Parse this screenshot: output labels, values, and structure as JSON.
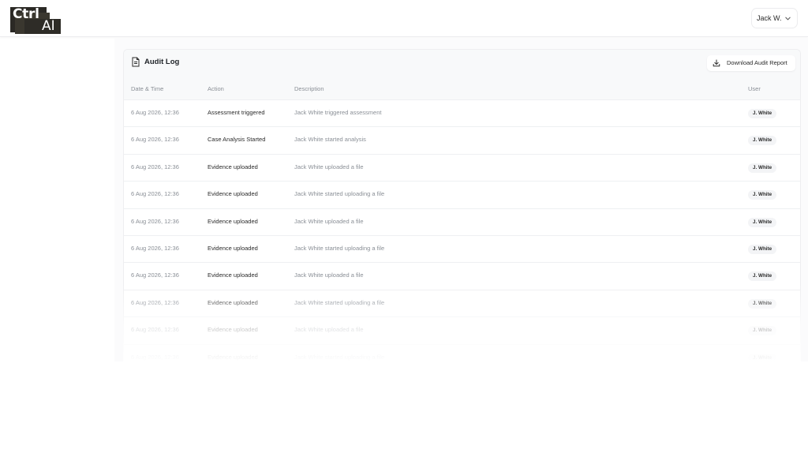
{
  "brand": {
    "line1": "Ctrl",
    "line2": "AI"
  },
  "user_menu": {
    "label": "Jack W.",
    "icon": "chevron-down-icon"
  },
  "audit": {
    "title": "Audit Log",
    "title_icon": "document-icon",
    "download_label": "Download Audit Report",
    "download_icon": "download-icon",
    "columns": {
      "date": "Date & Time",
      "action": "Action",
      "description": "Description",
      "user": "User"
    },
    "rows": [
      {
        "date": "6 Aug 2026, 12:36",
        "action": "Assessment triggered",
        "description": "Jack White triggered assessment",
        "user": "J. White"
      },
      {
        "date": "6 Aug 2026, 12:36",
        "action": "Case Analysis Started",
        "description": "Jack White started analysis",
        "user": "J. White"
      },
      {
        "date": "6 Aug 2026, 12:36",
        "action": "Evidence uploaded",
        "description": "Jack White uploaded a file",
        "user": "J. White"
      },
      {
        "date": "6 Aug 2026, 12:36",
        "action": "Evidence uploaded",
        "description": "Jack White started uploading a file",
        "user": "J. White"
      },
      {
        "date": "6 Aug 2026, 12:36",
        "action": "Evidence uploaded",
        "description": "Jack White uploaded a file",
        "user": "J. White"
      },
      {
        "date": "6 Aug 2026, 12:36",
        "action": "Evidence uploaded",
        "description": "Jack White started uploading a file",
        "user": "J. White"
      },
      {
        "date": "6 Aug 2026, 12:36",
        "action": "Evidence uploaded",
        "description": "Jack White uploaded a file",
        "user": "J. White"
      },
      {
        "date": "6 Aug 2026, 12:36",
        "action": "Evidence uploaded",
        "description": "Jack White started uploading a file",
        "user": "J. White"
      },
      {
        "date": "6 Aug 2026, 12:36",
        "action": "Evidence uploaded",
        "description": "Jack White uploaded a file",
        "user": "J. White"
      },
      {
        "date": "6 Aug 2026, 12:36",
        "action": "Evidence uploaded",
        "description": "Jack White started uploading a file",
        "user": "J. White"
      }
    ]
  }
}
